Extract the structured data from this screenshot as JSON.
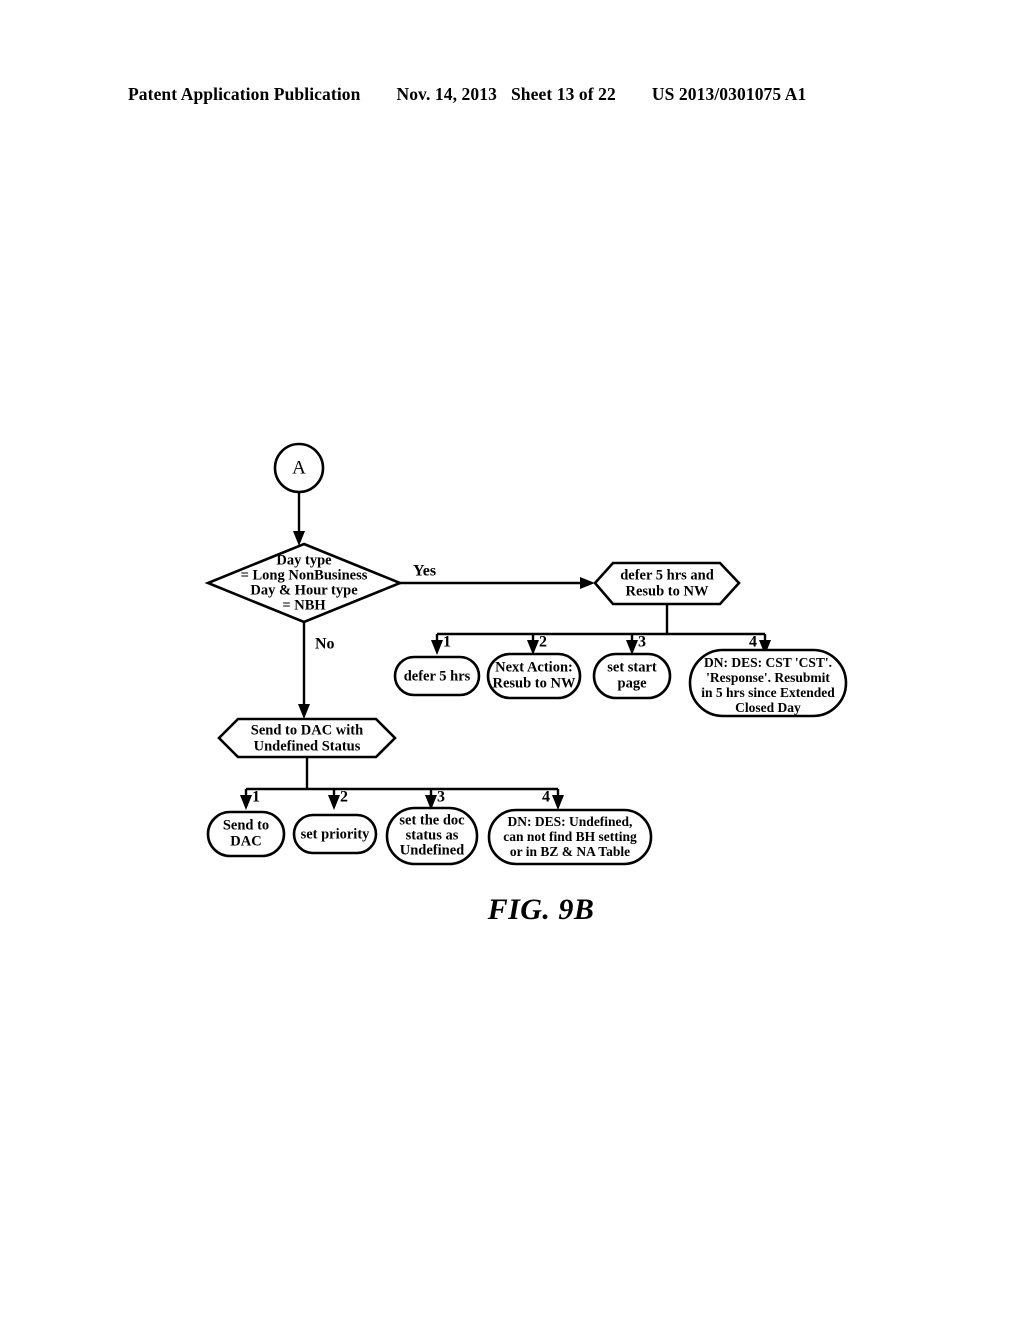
{
  "header": {
    "publication": "Patent Application Publication",
    "date": "Nov. 14, 2013",
    "sheet": "Sheet 13 of 22",
    "patent_number": "US 2013/0301075 A1"
  },
  "figure": {
    "caption": "FIG. 9B",
    "connector_in": "A",
    "decision": {
      "line1": "Day type",
      "line2": "= Long NonBusiness",
      "line3": "Day & Hour type",
      "line4": "= NBH",
      "yes_label": "Yes",
      "no_label": "No"
    },
    "yes_branch": {
      "process": {
        "line1": "defer 5 hrs and",
        "line2": "Resub to NW"
      },
      "steps": [
        {
          "index": "1",
          "lines": [
            "defer 5 hrs"
          ]
        },
        {
          "index": "2",
          "lines": [
            "Next Action:",
            "Resub to NW"
          ]
        },
        {
          "index": "3",
          "lines": [
            "set start",
            "page"
          ]
        },
        {
          "index": "4",
          "lines": [
            "DN: DES: CST 'CST'.",
            "'Response'. Resubmit",
            "in 5 hrs since Extended",
            "Closed Day"
          ]
        }
      ]
    },
    "no_branch": {
      "process": {
        "line1": "Send to DAC with",
        "line2": "Undefined Status"
      },
      "steps": [
        {
          "index": "1",
          "lines": [
            "Send to",
            "DAC"
          ]
        },
        {
          "index": "2",
          "lines": [
            "set priority"
          ]
        },
        {
          "index": "3",
          "lines": [
            "set the doc",
            "status as",
            "Undefined"
          ]
        },
        {
          "index": "4",
          "lines": [
            "DN: DES: Undefined,",
            "can not find BH setting",
            "or in BZ & NA Table"
          ]
        }
      ]
    }
  },
  "colors": {
    "ink": "#000000",
    "paper": "#ffffff"
  }
}
